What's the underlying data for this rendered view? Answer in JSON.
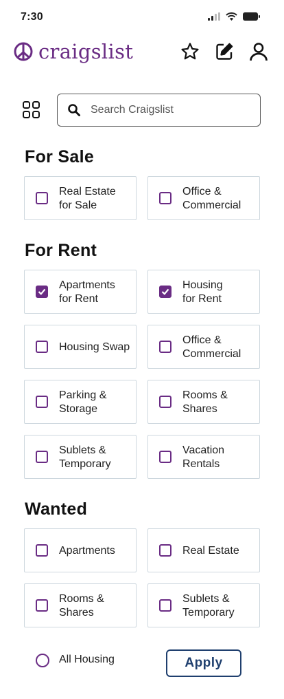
{
  "status_bar": {
    "time": "7:30"
  },
  "header": {
    "brand": "craigslist",
    "icons": [
      "peace-logo-icon",
      "star-icon",
      "edit-icon",
      "user-icon"
    ]
  },
  "search": {
    "placeholder": "Search Craigslist",
    "value": ""
  },
  "sections": {
    "for_sale": {
      "title": "For Sale",
      "items": [
        {
          "label": "Real Estate\nfor Sale",
          "checked": false
        },
        {
          "label": "Office &\nCommercial",
          "checked": false
        }
      ]
    },
    "for_rent": {
      "title": "For Rent",
      "items": [
        {
          "label": "Apartments\nfor Rent",
          "checked": true
        },
        {
          "label": "Housing\nfor Rent",
          "checked": true
        },
        {
          "label": "Housing Swap",
          "checked": false
        },
        {
          "label": "Office &\nCommercial",
          "checked": false
        },
        {
          "label": "Parking &\nStorage",
          "checked": false
        },
        {
          "label": "Rooms &\nShares",
          "checked": false
        },
        {
          "label": "Sublets &\nTemporary",
          "checked": false
        },
        {
          "label": "Vacation\nRentals",
          "checked": false
        }
      ]
    },
    "wanted": {
      "title": "Wanted",
      "items": [
        {
          "label": "Apartments",
          "checked": false
        },
        {
          "label": "Real Estate",
          "checked": false
        },
        {
          "label": "Rooms &\nShares",
          "checked": false
        },
        {
          "label": "Sublets &\nTemporary",
          "checked": false
        }
      ]
    }
  },
  "footer": {
    "all_housing_label": "All Housing",
    "all_housing_selected": false,
    "apply_label": "Apply"
  },
  "colors": {
    "accent": "#6a2c84",
    "button": "#1f3f6e",
    "card_border": "#cdd7de"
  }
}
